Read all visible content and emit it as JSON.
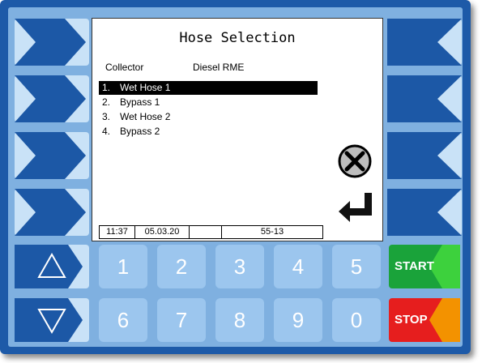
{
  "screen": {
    "title": "Hose Selection",
    "collector_label": "Collector",
    "product": "Diesel RME",
    "hoses": [
      {
        "num": "1.",
        "name": "Wet Hose 1",
        "selected": true
      },
      {
        "num": "2.",
        "name": "Bypass 1",
        "selected": false
      },
      {
        "num": "3.",
        "name": "Wet Hose 2",
        "selected": false
      },
      {
        "num": "4.",
        "name": "Bypass 2",
        "selected": false
      }
    ],
    "status": {
      "time": "11:37",
      "date": "05.03.20",
      "field3": "",
      "code": "55-13"
    }
  },
  "keypad": {
    "digits": [
      "1",
      "2",
      "3",
      "4",
      "5",
      "6",
      "7",
      "8",
      "9",
      "0"
    ],
    "start_label": "START",
    "stop_label": "STOP"
  },
  "colors": {
    "frame": "#1d5aa8",
    "softkey_shape": "#1c58a6",
    "start": "#1aa33a",
    "stop": "#e61e1e",
    "stop_accent": "#f39200",
    "start_accent": "#3dd13d"
  }
}
